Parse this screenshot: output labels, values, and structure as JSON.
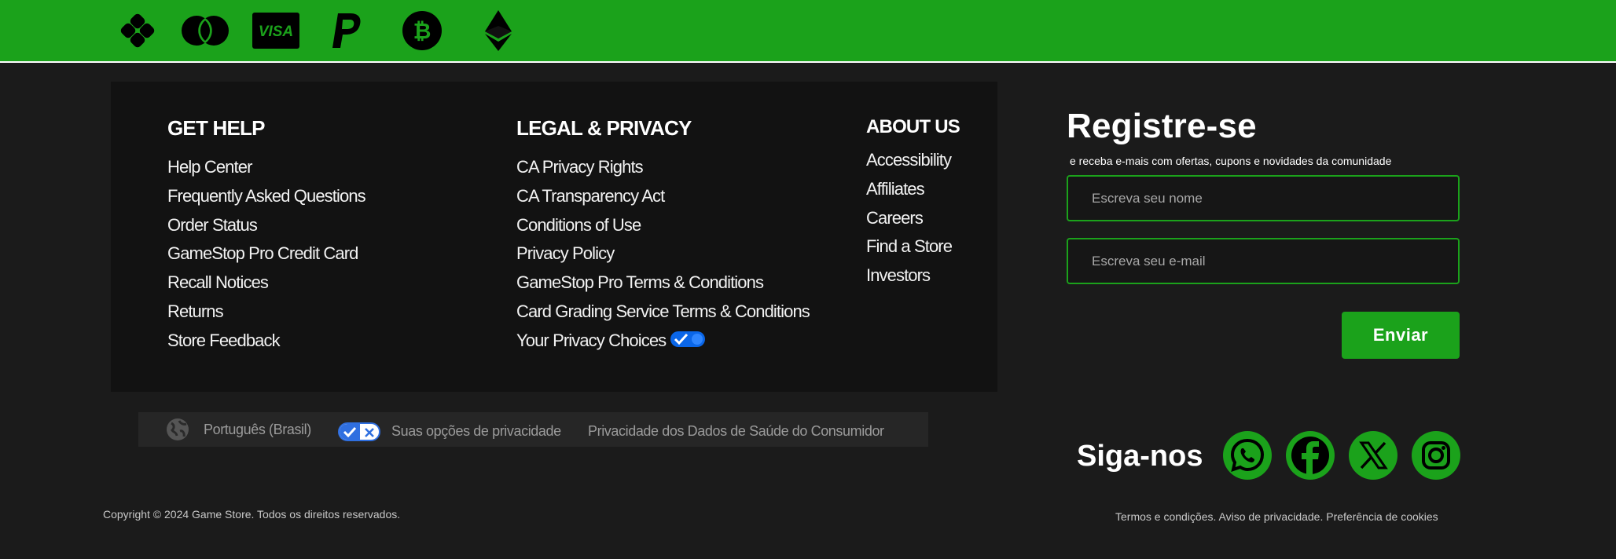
{
  "payments": [
    {
      "icon": "card-network-icon"
    },
    {
      "icon": "mastercard-icon"
    },
    {
      "icon": "visa-icon",
      "label": "VISA"
    },
    {
      "icon": "paypal-icon"
    },
    {
      "icon": "bitcoin-icon"
    },
    {
      "icon": "ethereum-icon"
    }
  ],
  "help": {
    "heading": "GET HELP",
    "items": [
      "Help Center",
      "Frequently Asked Questions",
      "Order Status",
      "GameStop Pro Credit Card",
      "Recall Notices",
      "Returns",
      "Store Feedback"
    ]
  },
  "legal": {
    "heading": "LEGAL & PRIVACY",
    "items": [
      "CA Privacy Rights",
      "CA Transparency Act",
      "Conditions of Use",
      "Privacy Policy",
      "GameStop Pro Terms & Conditions",
      "Card Grading Service Terms & Conditions",
      "Your Privacy Choices"
    ]
  },
  "about": {
    "heading": "ABOUT US",
    "items": [
      "Accessibility",
      "Affiliates",
      "Careers",
      "Find a Store",
      "Investors"
    ]
  },
  "strip": {
    "language": "Português (Brasil)",
    "privacy_choices": "Suas opções de privacidade",
    "health_privacy": "Privacidade dos Dados de Saúde do Consumidor"
  },
  "register": {
    "title": "Registre-se",
    "subtitle": "e receba e-mais com ofertas, cupons e novidades da comunidade",
    "name_placeholder": "Escreva seu nome",
    "email_placeholder": "Escreva seu e-mail",
    "submit_label": "Enviar"
  },
  "follow": {
    "title": "Siga-nos",
    "networks": [
      "whatsapp-icon",
      "facebook-icon",
      "x-icon",
      "instagram-icon"
    ]
  },
  "footer": {
    "copyright": "Copyright © 2024 Game Store. Todos os direitos reservados.",
    "terms": "Termos e condições.",
    "privacy": "Aviso de privacidade.",
    "cookies": "Preferência de cookies"
  },
  "colors": {
    "brand_green": "#1ba21b",
    "background": "#1b1b1b",
    "panel": "#121212"
  }
}
